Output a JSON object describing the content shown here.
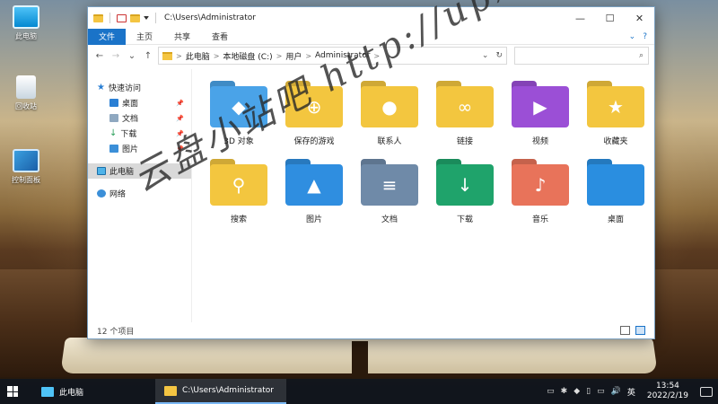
{
  "desktop": {
    "icons": [
      {
        "label": "此电脑",
        "icon": "this-pc-icon"
      },
      {
        "label": "回收站",
        "icon": "recycle-bin-icon"
      },
      {
        "label": "控制面板",
        "icon": "control-panel-icon"
      }
    ]
  },
  "window": {
    "title": "C:\\Users\\Administrator",
    "controls": {
      "minimize": "—",
      "maximize": "☐",
      "close": "✕"
    },
    "ribbon_tabs": [
      {
        "label": "文件",
        "active": true
      },
      {
        "label": "主页",
        "active": false
      },
      {
        "label": "共享",
        "active": false
      },
      {
        "label": "查看",
        "active": false
      }
    ],
    "ribbon_right": {
      "collapse": "⌄",
      "help": "?"
    },
    "nav": {
      "back": "←",
      "forward": "→",
      "recent": "⌄",
      "up": "↑"
    },
    "address": {
      "segments": [
        "此电脑",
        "本地磁盘 (C:)",
        "用户",
        "Administrator"
      ],
      "separator": ">",
      "dropdown": "⌄",
      "refresh": "↻"
    },
    "search": {
      "icon": "⌕"
    },
    "nav_pane": [
      {
        "label": "快速访问",
        "icon": "star-icon",
        "sub": false,
        "pinned": false,
        "selected": false
      },
      {
        "label": "桌面",
        "icon": "desktop-icon",
        "sub": true,
        "pinned": true,
        "selected": false
      },
      {
        "label": "文档",
        "icon": "documents-icon",
        "sub": true,
        "pinned": true,
        "selected": false
      },
      {
        "label": "下载",
        "icon": "download-icon",
        "sub": true,
        "pinned": true,
        "selected": false
      },
      {
        "label": "图片",
        "icon": "pictures-icon",
        "sub": true,
        "pinned": true,
        "selected": false
      },
      {
        "label": "此电脑",
        "icon": "this-pc-icon",
        "sub": false,
        "pinned": false,
        "selected": true
      },
      {
        "label": "网络",
        "icon": "network-icon",
        "sub": false,
        "pinned": false,
        "selected": false
      }
    ],
    "pin_glyph": "📌",
    "folders": [
      {
        "label": "3D 对象",
        "icon": "3d-objects-icon",
        "color": "#4aa3e8",
        "glyph": "◆"
      },
      {
        "label": "保存的游戏",
        "icon": "saved-games-icon",
        "color": "#f3c63f",
        "glyph": "⊕"
      },
      {
        "label": "联系人",
        "icon": "contacts-icon",
        "color": "#f3c63f",
        "glyph": "●"
      },
      {
        "label": "链接",
        "icon": "links-icon",
        "color": "#f3c63f",
        "glyph": "∞"
      },
      {
        "label": "视频",
        "icon": "videos-icon",
        "color": "#9b4fd6",
        "glyph": "▶"
      },
      {
        "label": "收藏夹",
        "icon": "favorites-icon",
        "color": "#f3c63f",
        "glyph": "★"
      },
      {
        "label": "搜索",
        "icon": "searches-icon",
        "color": "#f3c63f",
        "glyph": "⚲"
      },
      {
        "label": "图片",
        "icon": "pictures-icon",
        "color": "#2f8ee0",
        "glyph": "▲"
      },
      {
        "label": "文档",
        "icon": "documents-icon",
        "color": "#6f8aa8",
        "glyph": "≡"
      },
      {
        "label": "下载",
        "icon": "downloads-icon",
        "color": "#1fa36b",
        "glyph": "↓"
      },
      {
        "label": "音乐",
        "icon": "music-icon",
        "color": "#e8735a",
        "glyph": "♪"
      },
      {
        "label": "桌面",
        "icon": "desktop-icon",
        "color": "#2a8ee0",
        "glyph": ""
      }
    ],
    "status": "12 个项目"
  },
  "watermark": "云盘小站吧 http://upxzb.cn",
  "taskbar": {
    "items": [
      {
        "label": "此电脑",
        "icon": "this-pc-icon",
        "active": false
      },
      {
        "label": "C:\\Users\\Administrator",
        "icon": "folder-icon",
        "active": true
      }
    ],
    "tray": [
      "▭",
      "✱",
      "◆",
      "▯",
      "▭",
      "🔊",
      "英"
    ],
    "time": "13:54",
    "date": "2022/2/19"
  }
}
